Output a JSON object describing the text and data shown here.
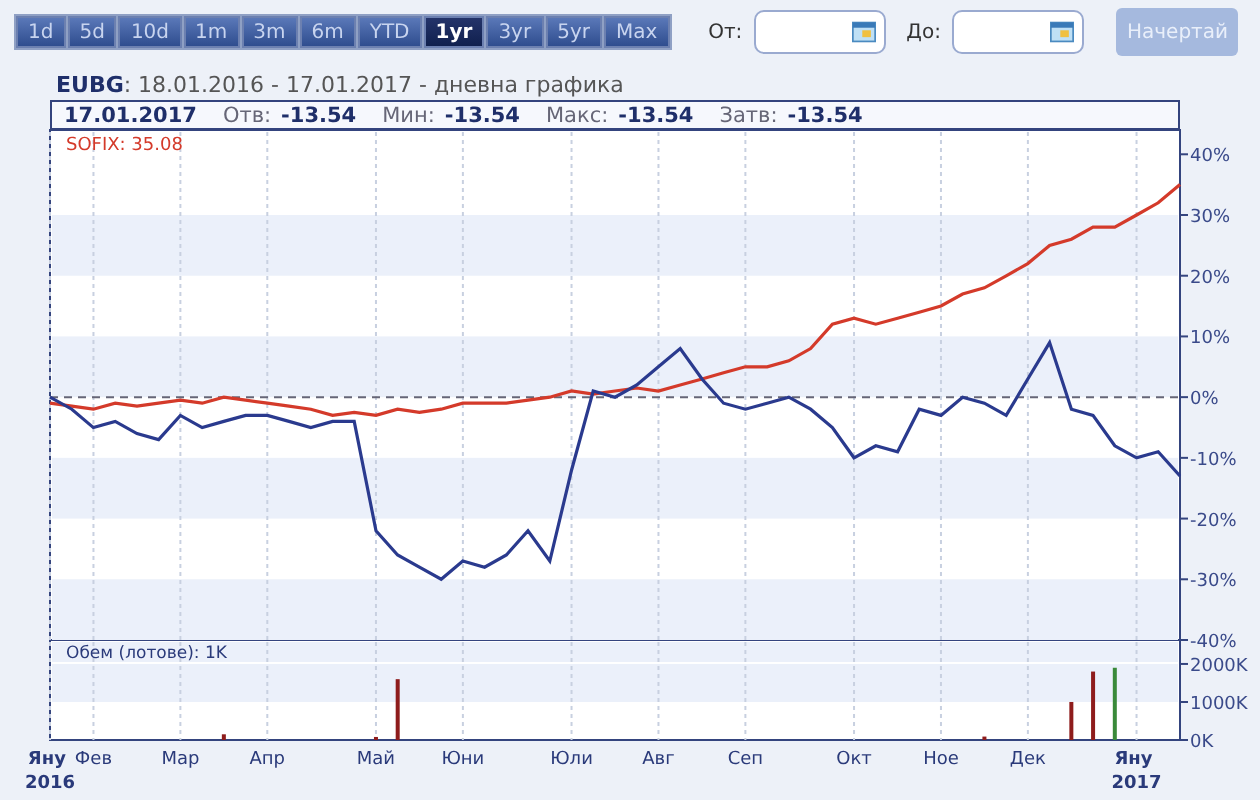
{
  "ranges": [
    {
      "label": "1d",
      "selected": false
    },
    {
      "label": "5d",
      "selected": false
    },
    {
      "label": "10d",
      "selected": false
    },
    {
      "label": "1m",
      "selected": false
    },
    {
      "label": "3m",
      "selected": false
    },
    {
      "label": "6m",
      "selected": false
    },
    {
      "label": "YTD",
      "selected": false
    },
    {
      "label": "1yr",
      "selected": true
    },
    {
      "label": "3yr",
      "selected": false
    },
    {
      "label": "5yr",
      "selected": false
    },
    {
      "label": "Max",
      "selected": false
    }
  ],
  "date_fields": [
    {
      "label": "От:"
    },
    {
      "label": "До:"
    }
  ],
  "draw_button": {
    "label": "Начертай",
    "disabled": true
  },
  "header": "**EUBG**: 18.01.2016 - 17.01.2017 - дневна графика",
  "quote": {
    "date": "17.01.2017",
    "items": [
      {
        "label": "Отв:",
        "value": "-13.54"
      },
      {
        "label": "Мин:",
        "value": "-13.54"
      },
      {
        "label": "Макс:",
        "value": "-13.54"
      },
      {
        "label": "Затв:",
        "value": "-13.54"
      }
    ]
  },
  "price_chart": {
    "legend": "SOFIX: 35.08",
    "chart_data": {
      "type": "line",
      "categories": [
        null,
        null,
        null,
        null,
        null,
        null,
        null,
        null,
        null,
        null,
        null,
        null,
        null,
        null,
        null,
        null,
        null,
        null,
        null,
        null,
        null,
        null,
        null,
        null,
        null,
        null,
        null,
        null,
        null,
        null,
        null,
        null,
        null,
        null,
        null,
        null,
        null,
        null,
        null,
        null,
        null,
        null,
        null,
        null,
        null,
        null,
        null,
        null,
        null,
        null,
        null,
        null,
        null
      ],
      "ylim": [
        -40,
        44
      ],
      "grid": true,
      "ref_lines": [
        {
          "axis": "y",
          "value": 0
        }
      ],
      "yticks": [
        {
          "value": 40,
          "label": "40%"
        },
        {
          "value": 30,
          "label": "30%"
        },
        {
          "value": 20,
          "label": "20%"
        },
        {
          "value": 10,
          "label": "10%"
        },
        {
          "value": 0,
          "label": "0%"
        },
        {
          "value": -10,
          "label": "-10%"
        },
        {
          "value": -20,
          "label": "-20%"
        },
        {
          "value": -30,
          "label": "-30%"
        },
        {
          "value": -40,
          "label": "-40%"
        }
      ],
      "series": [
        {
          "color": "#d43a2a",
          "values": [
            -1,
            -1.5,
            -2,
            -1,
            -1.5,
            -1,
            -0.5,
            -1,
            0,
            -0.5,
            -1,
            -1.5,
            -2,
            -3,
            -2.5,
            -3,
            -2,
            -2.5,
            -2,
            -1,
            -1,
            -1,
            -0.5,
            0,
            1,
            0.5,
            1,
            1.5,
            1,
            2,
            3,
            4,
            5,
            5,
            6,
            8,
            12,
            13,
            12,
            13,
            14,
            15,
            17,
            18,
            20,
            22,
            25,
            26,
            28,
            28,
            30,
            32,
            35
          ]
        },
        {
          "color": "#2a3a8e",
          "values": [
            0,
            -2,
            -5,
            -4,
            -6,
            -7,
            -3,
            -5,
            -4,
            -3,
            -3,
            -4,
            -5,
            -4,
            -4,
            -22,
            -26,
            -28,
            -30,
            -27,
            -28,
            -26,
            -22,
            -27,
            -12,
            1,
            0,
            2,
            5,
            8,
            3,
            -1,
            -2,
            -1,
            0,
            -2,
            -5,
            -10,
            -8,
            -9,
            -2,
            -3,
            0,
            -1,
            -3,
            3,
            9,
            -2,
            -3,
            -8,
            -10,
            -9,
            -13
          ]
        }
      ]
    }
  },
  "volume_chart": {
    "label": "Обем (лотове): 1K",
    "chart_data": {
      "type": "bar",
      "categories": [
        "Яну 2016",
        null,
        "Фев",
        null,
        null,
        null,
        "Мар",
        null,
        null,
        null,
        "Апр",
        null,
        null,
        null,
        null,
        "Май",
        null,
        null,
        null,
        "Юни",
        null,
        null,
        null,
        null,
        "Юли",
        null,
        null,
        null,
        "Авг",
        null,
        null,
        null,
        "Сеп",
        null,
        null,
        null,
        null,
        "Окт",
        null,
        null,
        null,
        "Ное",
        null,
        null,
        null,
        "Дек",
        null,
        null,
        null,
        null,
        "Яну 2017",
        null,
        null
      ],
      "ylim": [
        0,
        2630
      ],
      "grid": true,
      "yticks": [
        {
          "value": 2000,
          "label": "2000K"
        },
        {
          "value": 1000,
          "label": "1000K"
        },
        {
          "value": 0,
          "label": "0K"
        }
      ],
      "series": [
        {
          "color": "#8e1c1c",
          "values": [
            null,
            null,
            null,
            null,
            null,
            null,
            null,
            null,
            150,
            null,
            null,
            null,
            null,
            null,
            null,
            80,
            1600,
            null,
            null,
            null,
            null,
            null,
            null,
            null,
            null,
            null,
            null,
            null,
            null,
            null,
            null,
            null,
            null,
            null,
            null,
            null,
            null,
            null,
            null,
            null,
            null,
            null,
            null,
            90,
            null,
            null,
            null,
            1000,
            1800,
            null,
            null,
            null,
            null
          ]
        },
        {
          "color": "#3a8a3a",
          "values": [
            null,
            null,
            null,
            null,
            null,
            null,
            null,
            null,
            null,
            null,
            null,
            null,
            null,
            null,
            null,
            null,
            null,
            null,
            null,
            null,
            null,
            null,
            null,
            null,
            null,
            null,
            null,
            null,
            null,
            null,
            null,
            null,
            null,
            null,
            null,
            null,
            null,
            null,
            null,
            null,
            null,
            null,
            null,
            null,
            null,
            null,
            null,
            null,
            null,
            1900,
            null,
            null,
            null
          ]
        }
      ]
    }
  }
}
